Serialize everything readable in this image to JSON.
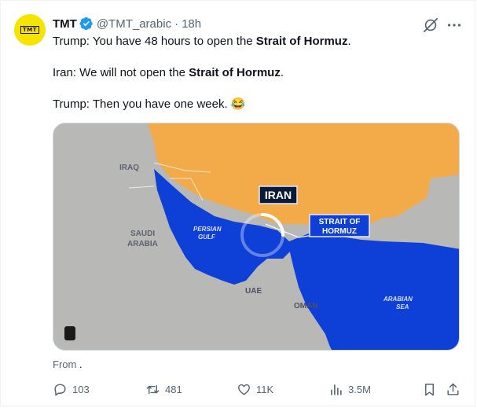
{
  "author": {
    "name": "TMT",
    "handle": "@TMT_arabic",
    "separator": "·",
    "time": "18h",
    "avatar_text": "TMT"
  },
  "tweet": {
    "lines": [
      {
        "prefix": "Trump: You have 48 hours to open the ",
        "bold": "Strait of Hormuz",
        "suffix": "."
      },
      {
        "prefix": "Iran: We will not open the ",
        "bold": "Strait of Hormuz",
        "suffix": "."
      },
      {
        "prefix": "Trump: Then you have one week. 😂",
        "bold": "",
        "suffix": ""
      }
    ]
  },
  "map": {
    "labels": {
      "iraq": "IRAQ",
      "iran": "IRAN",
      "saudi1": "SAUDI",
      "saudi2": "ARABIA",
      "persian1": "PERSIAN",
      "persian2": "GULF",
      "strait1": "STRAIT OF",
      "strait2": "HORMUZ",
      "uae": "UAE",
      "oman": "OMAN",
      "arabian1": "ARABIAN",
      "arabian2": "SEA"
    },
    "colors": {
      "land": "#b8b8b6",
      "iran": "#f2ab48",
      "water": "#0e3fd6"
    }
  },
  "from": {
    "label": "From",
    "name": "."
  },
  "actions": {
    "replies": "103",
    "reposts": "481",
    "likes": "11K",
    "views": "3.5M"
  },
  "icons": [
    "verified-badge-icon",
    "grok-icon",
    "more-icon",
    "reply-icon",
    "repost-icon",
    "like-icon",
    "views-icon",
    "bookmark-icon",
    "share-icon"
  ]
}
